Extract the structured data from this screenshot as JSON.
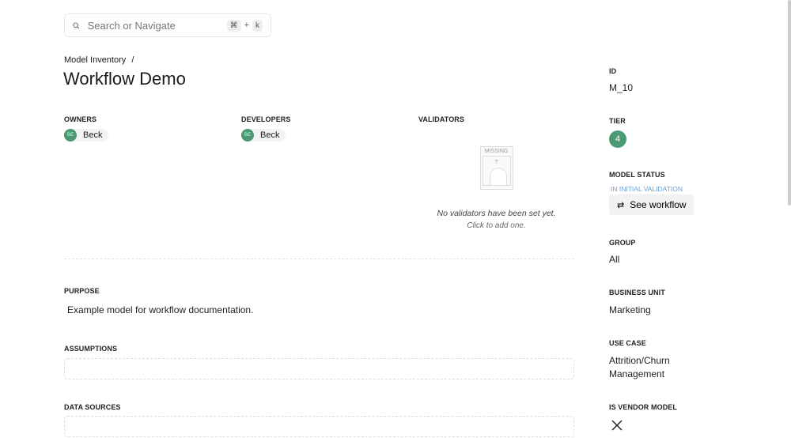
{
  "search": {
    "placeholder": "Search or Navigate",
    "shortcut_mod": "⌘",
    "shortcut_plus": "+",
    "shortcut_key": "k"
  },
  "breadcrumb": {
    "parent": "Model Inventory",
    "sep": "/"
  },
  "title": "Workflow Demo",
  "owners": {
    "label": "OWNERS",
    "people": [
      {
        "initials": "BE",
        "name": "Beck"
      }
    ]
  },
  "developers": {
    "label": "DEVELOPERS",
    "people": [
      {
        "initials": "BE",
        "name": "Beck"
      }
    ]
  },
  "validators": {
    "label": "VALIDATORS",
    "missing_badge": "MISSING",
    "empty_text": "No validators have been set yet.",
    "empty_hint": "Click to add one."
  },
  "purpose": {
    "label": "PURPOSE",
    "value": "Example model for workflow documentation."
  },
  "assumptions": {
    "label": "ASSUMPTIONS",
    "value": ""
  },
  "data_sources": {
    "label": "DATA SOURCES",
    "value": ""
  },
  "sidebar": {
    "id": {
      "label": "ID",
      "value": "M_10"
    },
    "tier": {
      "label": "TIER",
      "value": "4"
    },
    "status": {
      "label": "MODEL STATUS",
      "value": "IN INITIAL VALIDATION",
      "button": "See workflow"
    },
    "group": {
      "label": "GROUP",
      "value": "All"
    },
    "business_unit": {
      "label": "BUSINESS UNIT",
      "value": "Marketing"
    },
    "use_case": {
      "label": "USE CASE",
      "value": "Attrition/Churn Management"
    },
    "vendor": {
      "label": "IS VENDOR MODEL",
      "value_icon": "x-icon"
    }
  },
  "colors": {
    "accent_green": "#4b9a73",
    "status_blue": "#6a9fd6"
  }
}
